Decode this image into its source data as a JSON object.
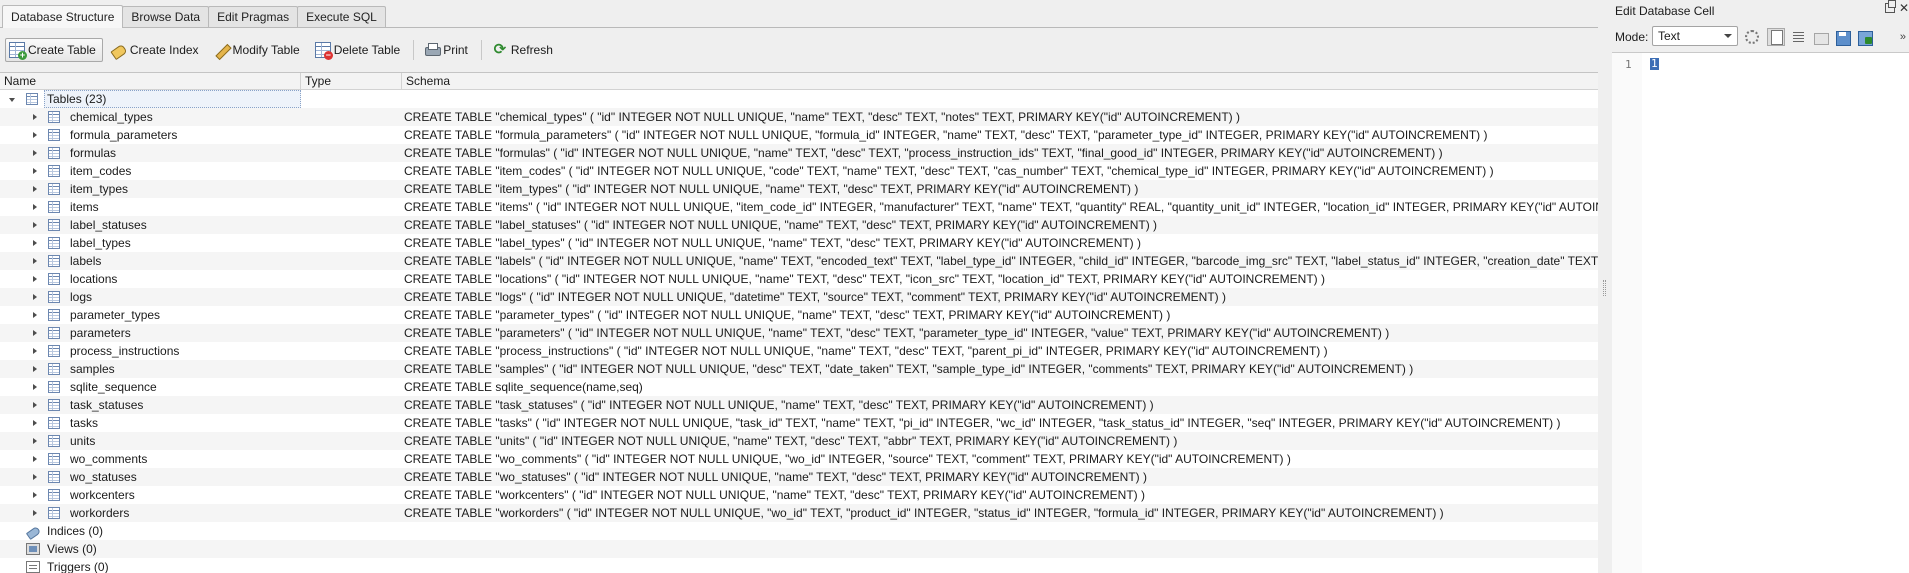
{
  "tabs": [
    {
      "label": "Database Structure"
    },
    {
      "label": "Browse Data"
    },
    {
      "label": "Edit Pragmas"
    },
    {
      "label": "Execute SQL"
    }
  ],
  "toolbar": {
    "create_table": "Create Table",
    "create_index": "Create Index",
    "modify_table": "Modify Table",
    "delete_table": "Delete Table",
    "print": "Print",
    "refresh": "Refresh"
  },
  "columns": {
    "name": "Name",
    "type": "Type",
    "schema": "Schema"
  },
  "tables_group": {
    "label": "Tables (23)"
  },
  "tables": [
    {
      "name": "chemical_types",
      "schema": "CREATE TABLE \"chemical_types\" ( \"id\" INTEGER NOT NULL UNIQUE, \"name\" TEXT, \"desc\" TEXT, \"notes\" TEXT, PRIMARY KEY(\"id\" AUTOINCREMENT) )"
    },
    {
      "name": "formula_parameters",
      "schema": "CREATE TABLE \"formula_parameters\" ( \"id\" INTEGER NOT NULL UNIQUE, \"formula_id\" INTEGER, \"name\" TEXT, \"desc\" TEXT, \"parameter_type_id\" INTEGER, PRIMARY KEY(\"id\" AUTOINCREMENT) )"
    },
    {
      "name": "formulas",
      "schema": "CREATE TABLE \"formulas\" ( \"id\" INTEGER NOT NULL UNIQUE, \"name\" TEXT, \"desc\" TEXT, \"process_instruction_ids\" TEXT, \"final_good_id\" INTEGER, PRIMARY KEY(\"id\" AUTOINCREMENT) )"
    },
    {
      "name": "item_codes",
      "schema": "CREATE TABLE \"item_codes\" ( \"id\" INTEGER NOT NULL UNIQUE, \"code\" TEXT, \"name\" TEXT, \"desc\" TEXT, \"cas_number\" TEXT, \"chemical_type_id\" INTEGER, PRIMARY KEY(\"id\" AUTOINCREMENT) )"
    },
    {
      "name": "item_types",
      "schema": "CREATE TABLE \"item_types\" ( \"id\" INTEGER NOT NULL UNIQUE, \"name\" TEXT, \"desc\" TEXT, PRIMARY KEY(\"id\" AUTOINCREMENT) )"
    },
    {
      "name": "items",
      "schema": "CREATE TABLE \"items\" ( \"id\" INTEGER NOT NULL UNIQUE, \"item_code_id\" INTEGER, \"manufacturer\" TEXT, \"name\" TEXT, \"quantity\" REAL, \"quantity_unit_id\" INTEGER, \"location_id\" INTEGER, PRIMARY KEY(\"id\" AUTOINCREMENT) )"
    },
    {
      "name": "label_statuses",
      "schema": "CREATE TABLE \"label_statuses\" ( \"id\" INTEGER NOT NULL UNIQUE, \"name\" TEXT, \"desc\" TEXT, PRIMARY KEY(\"id\" AUTOINCREMENT) )"
    },
    {
      "name": "label_types",
      "schema": "CREATE TABLE \"label_types\" ( \"id\" INTEGER NOT NULL UNIQUE, \"name\" TEXT, \"desc\" TEXT, PRIMARY KEY(\"id\" AUTOINCREMENT) )"
    },
    {
      "name": "labels",
      "schema": "CREATE TABLE \"labels\" ( \"id\" INTEGER NOT NULL UNIQUE, \"name\" TEXT, \"encoded_text\" TEXT, \"label_type_id\" INTEGER, \"child_id\" INTEGER, \"barcode_img_src\" TEXT, \"label_status_id\" INTEGER, \"creation_date\" TEXT, PRIMARY KEY(\"id\" AUTOINCREMENT) )"
    },
    {
      "name": "locations",
      "schema": "CREATE TABLE \"locations\" ( \"id\" INTEGER NOT NULL UNIQUE, \"name\" TEXT, \"desc\" TEXT, \"icon_src\" TEXT, \"location_id\" TEXT, PRIMARY KEY(\"id\" AUTOINCREMENT) )"
    },
    {
      "name": "logs",
      "schema": "CREATE TABLE \"logs\" ( \"id\" INTEGER NOT NULL UNIQUE, \"datetime\" TEXT, \"source\" TEXT, \"comment\" TEXT, PRIMARY KEY(\"id\" AUTOINCREMENT) )"
    },
    {
      "name": "parameter_types",
      "schema": "CREATE TABLE \"parameter_types\" ( \"id\" INTEGER NOT NULL UNIQUE, \"name\" TEXT, \"desc\" TEXT, PRIMARY KEY(\"id\" AUTOINCREMENT) )"
    },
    {
      "name": "parameters",
      "schema": "CREATE TABLE \"parameters\" ( \"id\" INTEGER NOT NULL UNIQUE, \"name\" TEXT, \"desc\" TEXT, \"parameter_type_id\" INTEGER, \"value\" TEXT, PRIMARY KEY(\"id\" AUTOINCREMENT) )"
    },
    {
      "name": "process_instructions",
      "schema": "CREATE TABLE \"process_instructions\" ( \"id\" INTEGER NOT NULL UNIQUE, \"name\" TEXT, \"desc\" TEXT, \"parent_pi_id\" INTEGER, PRIMARY KEY(\"id\" AUTOINCREMENT) )"
    },
    {
      "name": "samples",
      "schema": "CREATE TABLE \"samples\" ( \"id\" INTEGER NOT NULL UNIQUE, \"desc\" TEXT, \"date_taken\" TEXT, \"sample_type_id\" INTEGER, \"comments\" TEXT, PRIMARY KEY(\"id\" AUTOINCREMENT) )"
    },
    {
      "name": "sqlite_sequence",
      "schema": "CREATE TABLE sqlite_sequence(name,seq)"
    },
    {
      "name": "task_statuses",
      "schema": "CREATE TABLE \"task_statuses\" ( \"id\" INTEGER NOT NULL UNIQUE, \"name\" TEXT, \"desc\" TEXT, PRIMARY KEY(\"id\" AUTOINCREMENT) )"
    },
    {
      "name": "tasks",
      "schema": "CREATE TABLE \"tasks\" ( \"id\" INTEGER NOT NULL UNIQUE, \"task_id\" TEXT, \"name\" TEXT, \"pi_id\" INTEGER, \"wc_id\" INTEGER, \"task_status_id\" INTEGER, \"seq\" INTEGER, PRIMARY KEY(\"id\" AUTOINCREMENT) )"
    },
    {
      "name": "units",
      "schema": "CREATE TABLE \"units\" ( \"id\" INTEGER NOT NULL UNIQUE, \"name\" TEXT, \"desc\" TEXT, \"abbr\" TEXT, PRIMARY KEY(\"id\" AUTOINCREMENT) )"
    },
    {
      "name": "wo_comments",
      "schema": "CREATE TABLE \"wo_comments\" ( \"id\" INTEGER NOT NULL UNIQUE, \"wo_id\" INTEGER, \"source\" TEXT, \"comment\" TEXT, PRIMARY KEY(\"id\" AUTOINCREMENT) )"
    },
    {
      "name": "wo_statuses",
      "schema": "CREATE TABLE \"wo_statuses\" ( \"id\" INTEGER NOT NULL UNIQUE, \"name\" TEXT, \"desc\" TEXT, PRIMARY KEY(\"id\" AUTOINCREMENT) )"
    },
    {
      "name": "workcenters",
      "schema": "CREATE TABLE \"workcenters\" ( \"id\" INTEGER NOT NULL UNIQUE, \"name\" TEXT, \"desc\" TEXT, PRIMARY KEY(\"id\" AUTOINCREMENT) )"
    },
    {
      "name": "workorders",
      "schema": "CREATE TABLE \"workorders\" ( \"id\" INTEGER NOT NULL UNIQUE, \"wo_id\" TEXT, \"product_id\" INTEGER, \"status_id\" INTEGER, \"formula_id\" INTEGER, PRIMARY KEY(\"id\" AUTOINCREMENT) )"
    }
  ],
  "other_groups": [
    {
      "label": "Indices (0)",
      "icon": "index-icon"
    },
    {
      "label": "Views (0)",
      "icon": "view-icon"
    },
    {
      "label": "Triggers (0)",
      "icon": "trigger-icon"
    }
  ],
  "edit_cell": {
    "title": "Edit Database Cell",
    "mode_label": "Mode:",
    "mode_value": "Text",
    "line_number": "1",
    "value": "1",
    "more": "»"
  },
  "colors": {
    "selection": "#3d6eb5",
    "pane_bg": "#efefef"
  }
}
